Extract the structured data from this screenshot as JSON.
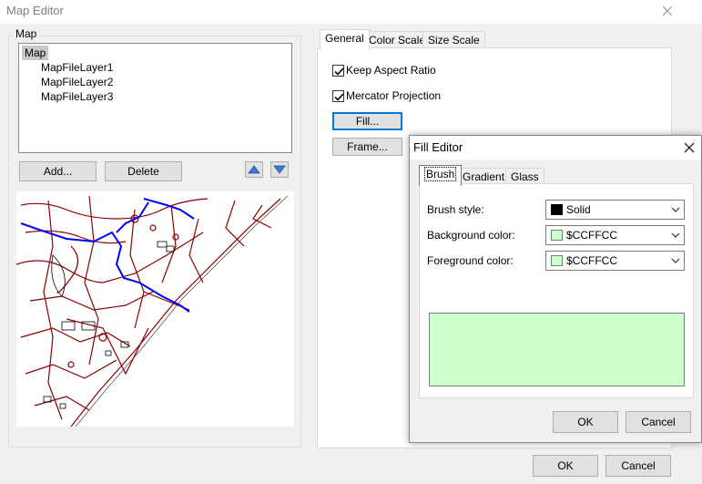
{
  "main": {
    "title": "Map Editor",
    "group_label": "Map",
    "tree": {
      "root": "Map",
      "layers": [
        "MapFileLayer1",
        "MapFileLayer2",
        "MapFileLayer3"
      ]
    },
    "buttons": {
      "add": "Add...",
      "delete": "Delete",
      "ok": "OK",
      "cancel": "Cancel"
    },
    "tabs": [
      "General",
      "Color Scale",
      "Size Scale"
    ],
    "active_tab": "General",
    "options": {
      "keep_aspect_ratio": {
        "label": "Keep Aspect Ratio",
        "checked": true
      },
      "mercator_projection": {
        "label": "Mercator Projection",
        "checked": true
      }
    },
    "fill_button": "Fill...",
    "frame_button": "Frame..."
  },
  "fill_editor": {
    "title": "Fill Editor",
    "tabs": [
      "Brush",
      "Gradient",
      "Glass"
    ],
    "active_tab": "Brush",
    "brush_style": {
      "label": "Brush style:",
      "value": "Solid",
      "swatch_color": "#000000"
    },
    "background_color": {
      "label": "Background color:",
      "value": "$CCFFCC",
      "swatch_color": "#CCFFCC"
    },
    "foreground_color": {
      "label": "Foreground color:",
      "value": "$CCFFCC",
      "swatch_color": "#CCFFCC"
    },
    "preview_color": "#CCFFCC",
    "buttons": {
      "ok": "OK",
      "cancel": "Cancel"
    }
  },
  "colors": {
    "accent": "#0078d7",
    "map_roads": "#8b0000",
    "map_river": "#0000ff"
  }
}
